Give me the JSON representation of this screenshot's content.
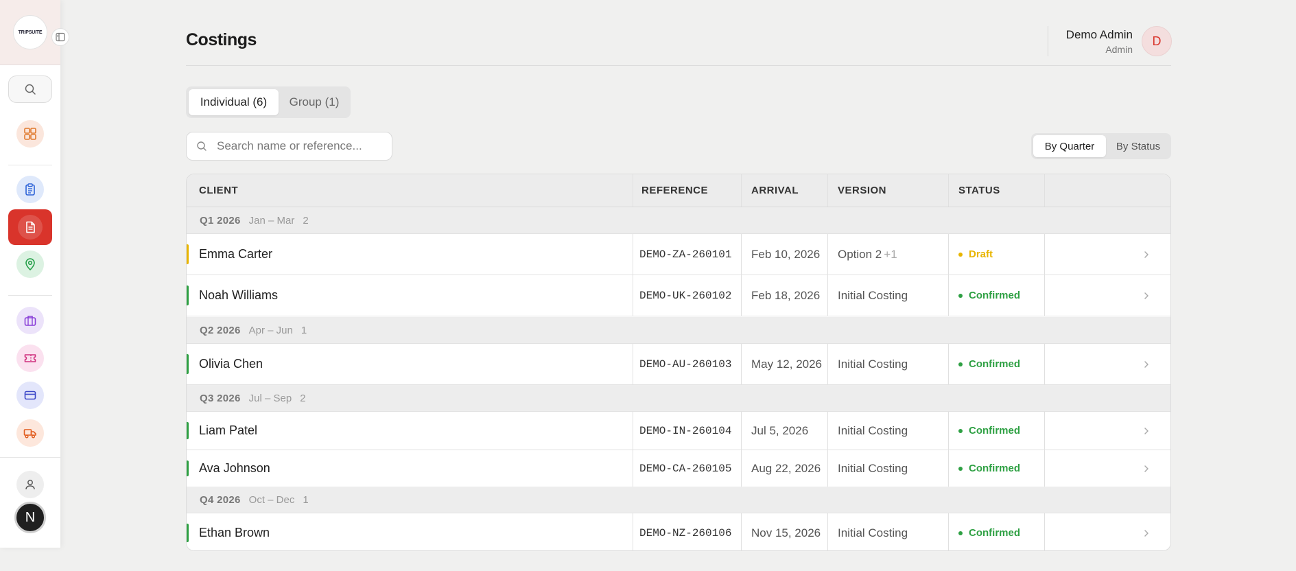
{
  "app": {
    "logo_text": "TRIPSUITE"
  },
  "header": {
    "title": "Costings"
  },
  "user": {
    "name": "Demo Admin",
    "role": "Admin",
    "initial": "D"
  },
  "sidebar": {
    "bottom_avatar": "N"
  },
  "tabs": [
    {
      "label": "Individual (6)",
      "active": true
    },
    {
      "label": "Group (1)",
      "active": false
    }
  ],
  "search": {
    "placeholder": "Search name or reference..."
  },
  "view_toggle": [
    {
      "label": "By Quarter",
      "active": true
    },
    {
      "label": "By Status",
      "active": false
    }
  ],
  "table": {
    "columns": [
      "CLIENT",
      "REFERENCE",
      "ARRIVAL",
      "VERSION",
      "STATUS"
    ],
    "groups": [
      {
        "quarter": "Q1 2026",
        "range": "Jan – Mar",
        "count": "2",
        "rows": [
          {
            "client": "Emma Carter",
            "reference": "DEMO-ZA-260101",
            "arrival": "Feb 10, 2026",
            "version": "Option 2",
            "version_extra": "+1",
            "status": "Draft"
          },
          {
            "client": "Noah Williams",
            "reference": "DEMO-UK-260102",
            "arrival": "Feb 18, 2026",
            "version": "Initial Costing",
            "status": "Confirmed"
          }
        ]
      },
      {
        "quarter": "Q2 2026",
        "range": "Apr – Jun",
        "count": "1",
        "rows": [
          {
            "client": "Olivia Chen",
            "reference": "DEMO-AU-260103",
            "arrival": "May 12, 2026",
            "version": "Initial Costing",
            "status": "Confirmed"
          }
        ]
      },
      {
        "quarter": "Q3 2026",
        "range": "Jul – Sep",
        "count": "2",
        "rows": [
          {
            "client": "Liam Patel",
            "reference": "DEMO-IN-260104",
            "arrival": "Jul 5, 2026",
            "version": "Initial Costing",
            "status": "Confirmed"
          },
          {
            "client": "Ava Johnson",
            "reference": "DEMO-CA-260105",
            "arrival": "Aug 22, 2026",
            "version": "Initial Costing",
            "status": "Confirmed"
          }
        ]
      },
      {
        "quarter": "Q4 2026",
        "range": "Oct – Dec",
        "count": "1",
        "rows": [
          {
            "client": "Ethan Brown",
            "reference": "DEMO-NZ-260106",
            "arrival": "Nov 15, 2026",
            "version": "Initial Costing",
            "status": "Confirmed"
          }
        ]
      }
    ]
  },
  "colors": {
    "brand_red": "#d9342b",
    "draft": "#e8b500",
    "confirmed": "#2ea043"
  }
}
